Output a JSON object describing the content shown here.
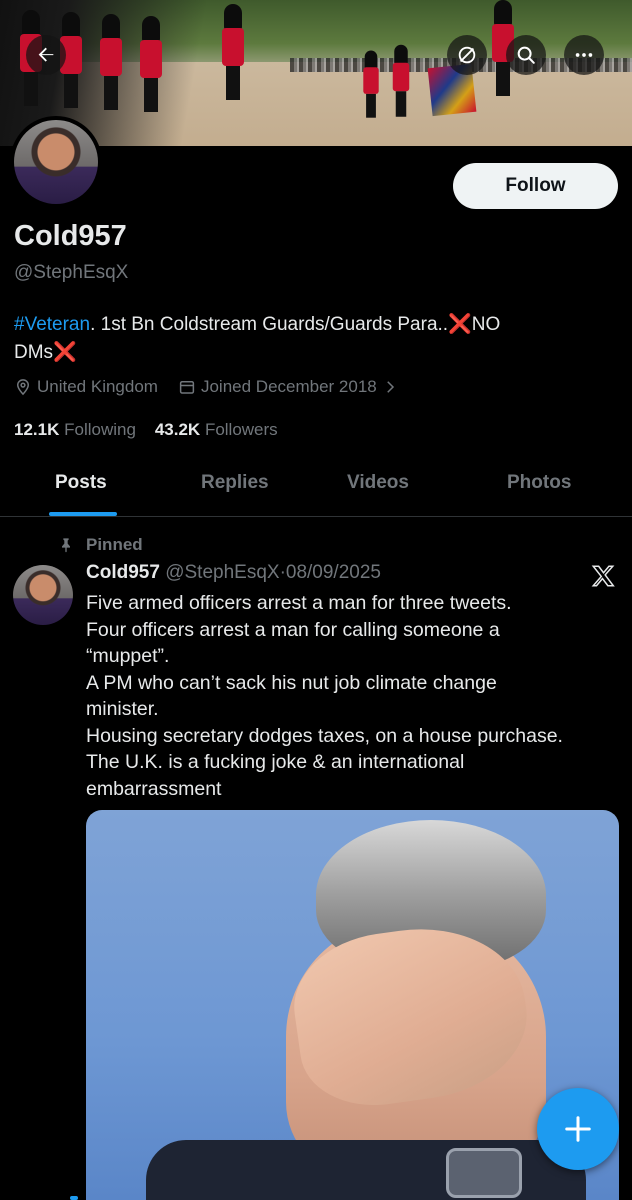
{
  "header": {
    "back_icon": "arrow-left-icon",
    "grok_icon": "grok-icon",
    "search_icon": "search-icon",
    "more_icon": "more-horizontal-icon"
  },
  "profile": {
    "display_name": "Cold957",
    "handle": "@StephEsqX",
    "follow_label": "Follow",
    "bio": {
      "hashtag": "#Veteran",
      "text_line1": ". 1st Bn Coldstream Guards/Guards Para..",
      "no": "NO",
      "text_line2": "DMs",
      "cross": "❌"
    },
    "location": "United Kingdom",
    "joined": "Joined December 2018",
    "following_count": "12.1K",
    "following_label": "Following",
    "followers_count": "43.2K",
    "followers_label": "Followers"
  },
  "tabs": [
    {
      "label": "Posts",
      "active": true
    },
    {
      "label": "Replies",
      "active": false
    },
    {
      "label": "Videos",
      "active": false
    },
    {
      "label": "Photos",
      "active": false
    }
  ],
  "pinned_post": {
    "pinned_label": "Pinned",
    "author_name": "Cold957",
    "author_handle": "@StephEsqX",
    "separator": "·",
    "date": "08/09/2025",
    "lines": [
      "Five armed officers arrest a man for three tweets.",
      "Four officers arrest a man for calling someone a",
      "“muppet”.",
      "A PM who can’t sack his nut job climate change",
      "minister.",
      "Housing secretary dodges taxes, on a house purchase.",
      "The U.K. is a fucking joke & an international",
      "embarrassment"
    ]
  },
  "fab": {
    "icon": "plus-icon"
  },
  "colors": {
    "accent": "#1d9bf0",
    "background": "#000000",
    "text": "#e7e9ea",
    "muted": "#71767b",
    "danger": "#f4212e"
  }
}
